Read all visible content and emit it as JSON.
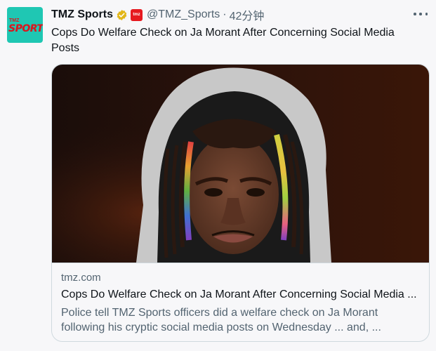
{
  "account": {
    "avatar_small_text": "TMZ",
    "avatar_text": "SPORTS",
    "display_name": "TMZ Sports",
    "affiliate_badge_text": "tmz",
    "handle": "@TMZ_Sports",
    "separator": "·",
    "time_ago": "42分钟"
  },
  "icons": {
    "verified": "verified-gold-badge-icon",
    "affiliate": "affiliate-badge-icon",
    "more": "more-horizontal-icon"
  },
  "colors": {
    "brand_avatar_bg": "#1fc7b3",
    "brand_red": "#e6191f",
    "verified_gold": "#e2b719",
    "secondary_text": "#536471"
  },
  "tweet": {
    "text": "Cops Do Welfare Check on Ja Morant After Concerning Social Media Posts"
  },
  "card": {
    "domain": "tmz.com",
    "title": "Cops Do Welfare Check on Ja Morant After Concerning Social Media ...",
    "description": "Police tell TMZ Sports officers did a welfare check on Ja Morant following his cryptic social media posts on Wednesday ... and, ..."
  }
}
